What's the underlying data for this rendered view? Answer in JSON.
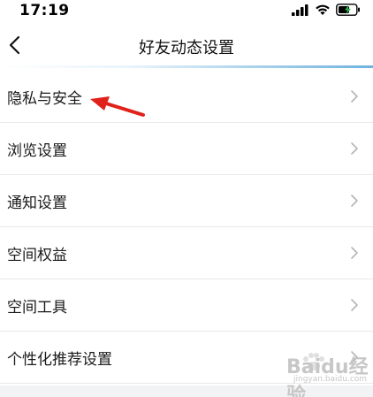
{
  "status_bar": {
    "time": "17:19",
    "icons": [
      "signal-icon",
      "wifi-icon",
      "battery-charging-icon"
    ]
  },
  "nav": {
    "title": "好友动态设置",
    "back_icon": "chevron-left-icon"
  },
  "menu": {
    "items": [
      {
        "label": "隐私与安全"
      },
      {
        "label": "浏览设置"
      },
      {
        "label": "通知设置"
      },
      {
        "label": "空间权益"
      },
      {
        "label": "空间工具"
      },
      {
        "label": "个性化推荐设置"
      }
    ],
    "chevron_icon": "chevron-right-icon"
  },
  "annotation": {
    "arrow_color": "#e0221b"
  },
  "watermark": {
    "text": "Baidu经验",
    "sub": "jingyan.baidu.com"
  },
  "colors": {
    "accent_line": "#6fb3e0",
    "divider": "#e9e9e9",
    "chevron": "#b5b5b5"
  }
}
